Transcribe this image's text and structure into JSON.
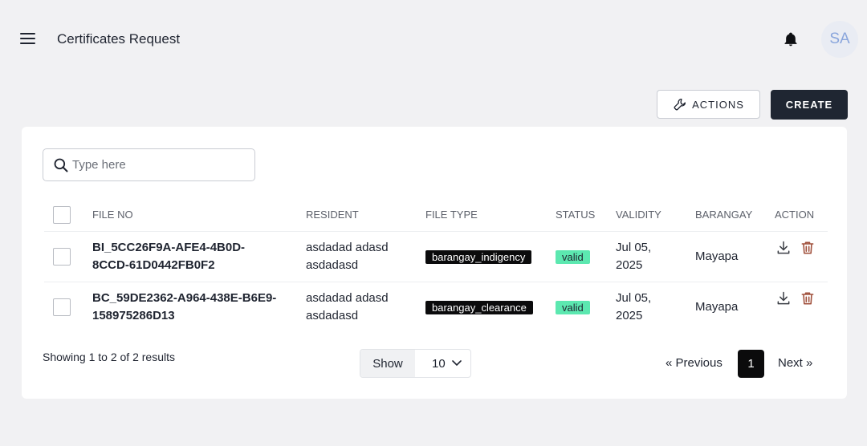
{
  "header": {
    "title": "Certificates Request",
    "avatar_initials": "SA"
  },
  "toolbar": {
    "actions_label": "ACTIONS",
    "create_label": "CREATE"
  },
  "search": {
    "placeholder": "Type here",
    "value": ""
  },
  "table": {
    "columns": [
      "FILE NO",
      "RESIDENT",
      "FILE TYPE",
      "STATUS",
      "VALIDITY",
      "BARANGAY",
      "ACTION"
    ],
    "rows": [
      {
        "file_no_line1": "BI_5CC26F9A-AFE4-4B0D-",
        "file_no_line2": "8CCD-61D0442FB0F2",
        "resident_line1": "asdadad adasd",
        "resident_line2": "asdadasd",
        "file_type": "barangay_indigency",
        "status": "valid",
        "validity_line1": "Jul 05,",
        "validity_line2": "2025",
        "barangay": "Mayapa"
      },
      {
        "file_no_line1": "BC_59DE2362-A964-438E-B6E9-",
        "file_no_line2": "158975286D13",
        "resident_line1": "asdadad adasd",
        "resident_line2": "asdadasd",
        "file_type": "barangay_clearance",
        "status": "valid",
        "validity_line1": "Jul 05,",
        "validity_line2": "2025",
        "barangay": "Mayapa"
      }
    ]
  },
  "footer": {
    "showing_text": "Showing 1 to 2 of 2 results",
    "show_label": "Show",
    "page_size": "10",
    "prev_label": "« Previous",
    "current_page": "1",
    "next_label": "Next »"
  },
  "colors": {
    "primary_dark": "#1f2632",
    "status_valid": "#5ce8b0",
    "delete_icon": "#a0503c"
  }
}
